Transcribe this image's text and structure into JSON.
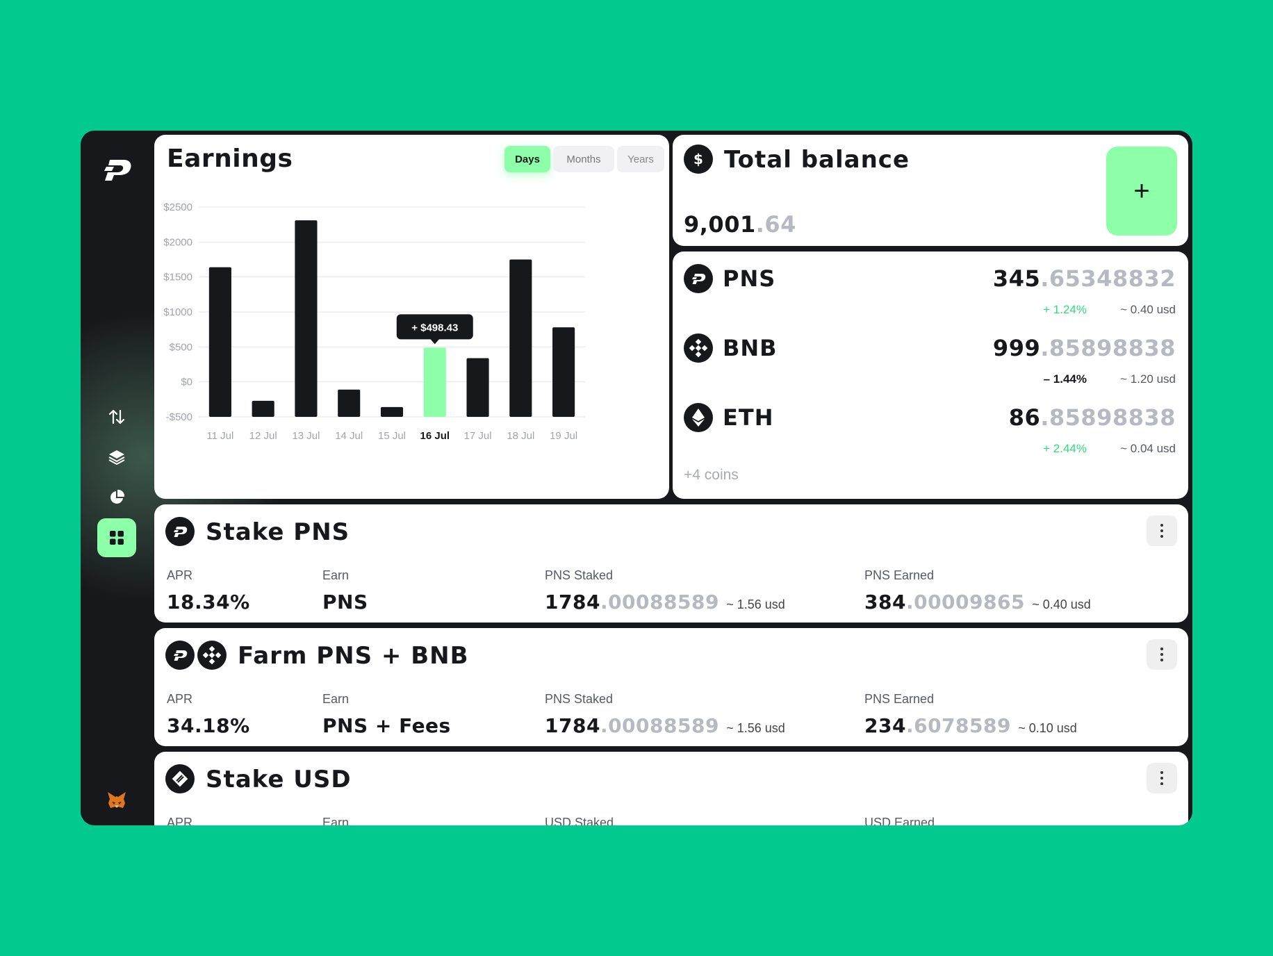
{
  "sidebar": {
    "logo_icon": "pns-logo-icon",
    "nav_items": [
      {
        "icon": "swap-arrows-icon",
        "active": false
      },
      {
        "icon": "layers-icon",
        "active": false
      },
      {
        "icon": "pie-chart-icon",
        "active": false
      },
      {
        "icon": "grid-icon",
        "active": true
      }
    ],
    "wallet_icon": "metamask-fox-icon"
  },
  "earnings": {
    "title": "Earnings",
    "toggles": {
      "days": "Days",
      "months": "Months",
      "years": "Years",
      "selected": "Days"
    },
    "tooltip": "+ $498.43"
  },
  "chart_data": {
    "type": "bar",
    "title": "Earnings",
    "categories": [
      "11 Jul",
      "12 Jul",
      "13 Jul",
      "14 Jul",
      "15 Jul",
      "16 Jul",
      "17 Jul",
      "18 Jul",
      "19 Jul"
    ],
    "values": [
      1640,
      -270,
      2310,
      -110,
      -360,
      490,
      340,
      1750,
      780
    ],
    "highlight_index": 5,
    "y_ticks": [
      "$2500",
      "$2000",
      "$1500",
      "$1000",
      "$500",
      "$0",
      "-$500"
    ],
    "ylim": [
      -500,
      2500
    ],
    "grid": true,
    "colors": {
      "bar": "#17181c",
      "highlight": "#8effa9",
      "grid": "#e4e5e8"
    }
  },
  "balance": {
    "title": "Total balance",
    "icon": "dollar-icon",
    "amount_int": "9,001",
    "amount_dec": ".64",
    "add_button": "+"
  },
  "coins": {
    "items": [
      {
        "name": "PNS",
        "icon": "pns-logo-icon",
        "int": "345",
        "dec": ".65348832",
        "change": "+ 1.24%",
        "change_positive": true,
        "usd": "~ 0.40 usd"
      },
      {
        "name": "BNB",
        "icon": "bnb-icon",
        "int": "999",
        "dec": ".85898838",
        "change": "– 1.44%",
        "change_positive": false,
        "usd": "~ 1.20 usd"
      },
      {
        "name": "ETH",
        "icon": "eth-icon",
        "int": "86",
        "dec": ".85898838",
        "change": "+ 2.44%",
        "change_positive": true,
        "usd": "~ 0.04 usd"
      }
    ],
    "more": "+4 coins"
  },
  "pools": [
    {
      "title": "Stake PNS",
      "labels": {
        "apr": "APR",
        "earn": "Earn",
        "staked": "PNS Staked",
        "earned": "PNS Earned"
      },
      "apr": "18.34%",
      "earn": "PNS",
      "staked_int": "1784",
      "staked_dec": ".00088589",
      "staked_usd": "~ 1.56 usd",
      "earned_int": "384",
      "earned_dec": ".00009865",
      "earned_usd": "~ 0.40 usd"
    },
    {
      "title": "Farm PNS + BNB",
      "labels": {
        "apr": "APR",
        "earn": "Earn",
        "staked": "PNS Staked",
        "earned": "PNS Earned"
      },
      "apr": "34.18%",
      "earn": "PNS + Fees",
      "staked_int": "1784",
      "staked_dec": ".00088589",
      "staked_usd": "~ 1.56 usd",
      "earned_int": "234",
      "earned_dec": ".6078589",
      "earned_usd": "~ 0.10 usd"
    },
    {
      "title": "Stake USD",
      "labels": {
        "apr": "APR",
        "earn": "Earn",
        "staked": "USD Staked",
        "earned": "USD Earned"
      }
    }
  ]
}
